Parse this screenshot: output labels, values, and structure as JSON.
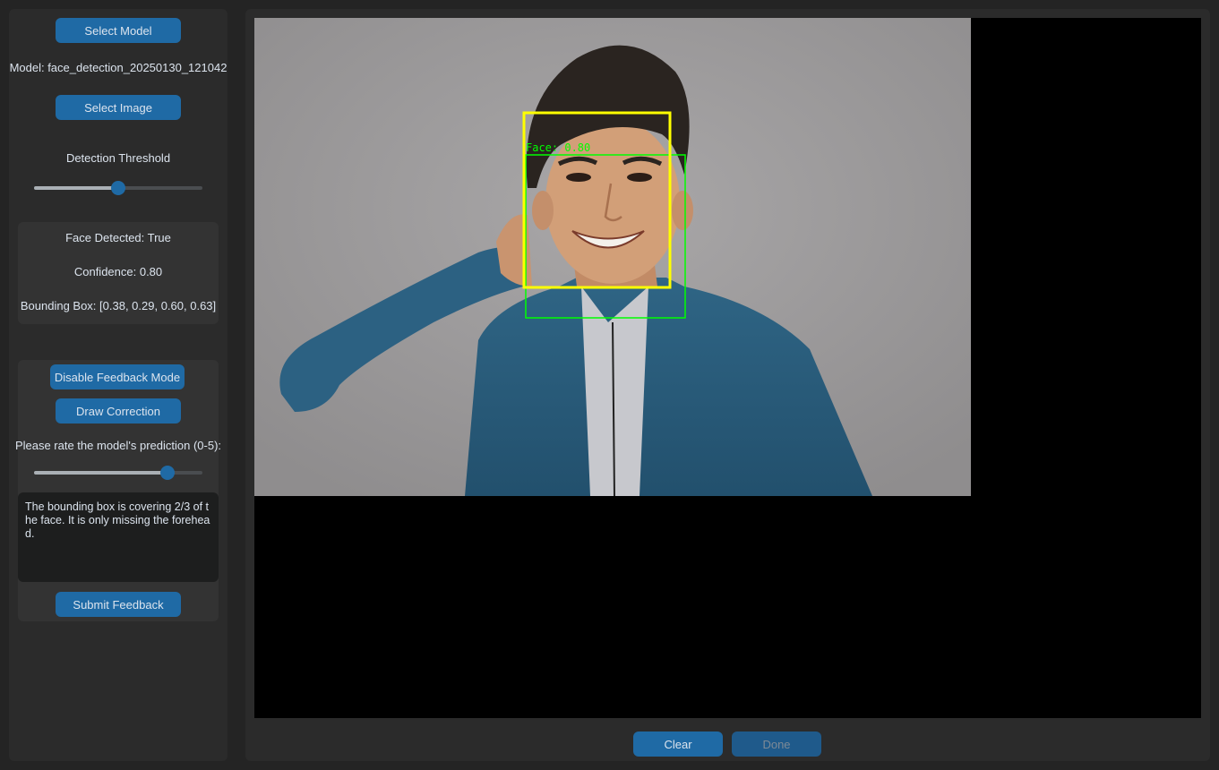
{
  "sidebar": {
    "select_model_label": "Select Model",
    "model_text": "Model: face_detection_20250130_121042",
    "select_image_label": "Select Image",
    "threshold_label": "Detection Threshold",
    "threshold_value": 0.5,
    "results": {
      "face_detected": "Face Detected: True",
      "confidence": "Confidence: 0.80",
      "bounding_box": "Bounding Box: [0.38, 0.29, 0.60, 0.63]"
    },
    "feedback": {
      "disable_mode_label": "Disable Feedback Mode",
      "draw_correction_label": "Draw Correction",
      "rating_prompt": "Please rate the model's prediction (0-5):",
      "rating_value": 4,
      "rating_max": 5,
      "comment": "The bounding box is covering 2/3 of the face. It is only missing the forehead.",
      "submit_label": "Submit Feedback"
    }
  },
  "canvas": {
    "face_label": "Face: 0.80",
    "predicted_box_color": "#00ff00",
    "correction_box_color": "#ffff00"
  },
  "footer": {
    "clear_label": "Clear",
    "done_label": "Done"
  },
  "colors": {
    "accent": "#1f6aa5",
    "background": "#242424",
    "panel": "#2b2b2b"
  }
}
